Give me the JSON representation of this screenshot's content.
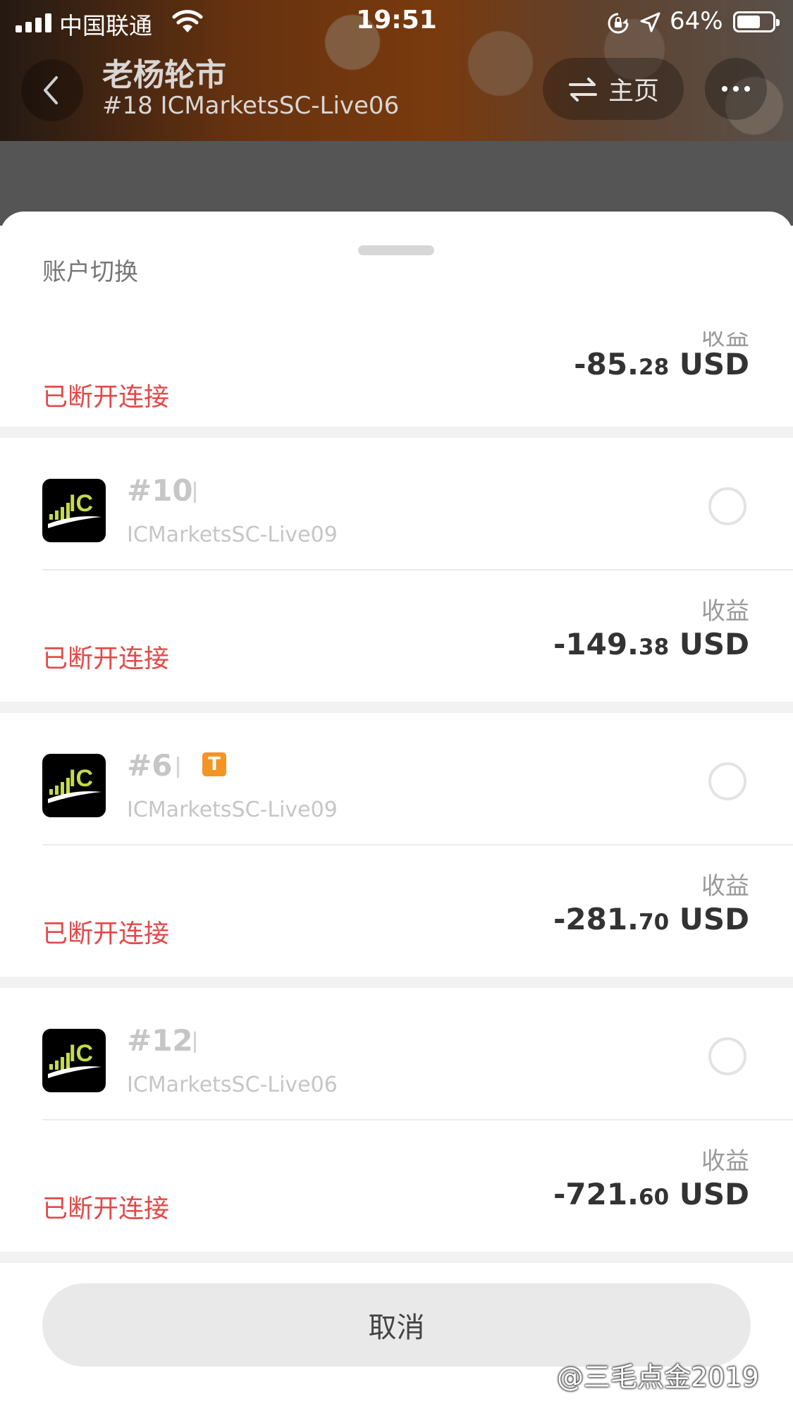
{
  "status_bar": {
    "carrier": "中国联通",
    "time": "19:51",
    "battery": "64%"
  },
  "nav": {
    "title": "老杨轮市",
    "subtitle": "#18 ICMarketsSC-Live06",
    "home_label": "主页"
  },
  "sheet": {
    "title": "账户切换",
    "first_card": {
      "status": "已断开连接",
      "profit_label": "收益",
      "profit_int": "-85.",
      "profit_dec": "28",
      "currency": "USD"
    },
    "accounts": [
      {
        "number": "#10",
        "server": "ICMarketsSC-Live09",
        "badge": "",
        "status": "已断开连接",
        "profit_label": "收益",
        "profit_int": "-149.",
        "profit_dec": "38",
        "currency": "USD"
      },
      {
        "number": "#6",
        "server": "ICMarketsSC-Live09",
        "badge": "T",
        "status": "已断开连接",
        "profit_label": "收益",
        "profit_int": "-281.",
        "profit_dec": "70",
        "currency": "USD"
      },
      {
        "number": "#12",
        "server": "ICMarketsSC-Live06",
        "badge": "",
        "status": "已断开连接",
        "profit_label": "收益",
        "profit_int": "-721.",
        "profit_dec": "60",
        "currency": "USD"
      }
    ],
    "cancel_label": "取消"
  },
  "logo_text": "IC",
  "watermark": "@三毛点金2019",
  "colors": {
    "disconnected": "#e34949",
    "badge": "#f39423",
    "header_orange": "#c35e17"
  }
}
